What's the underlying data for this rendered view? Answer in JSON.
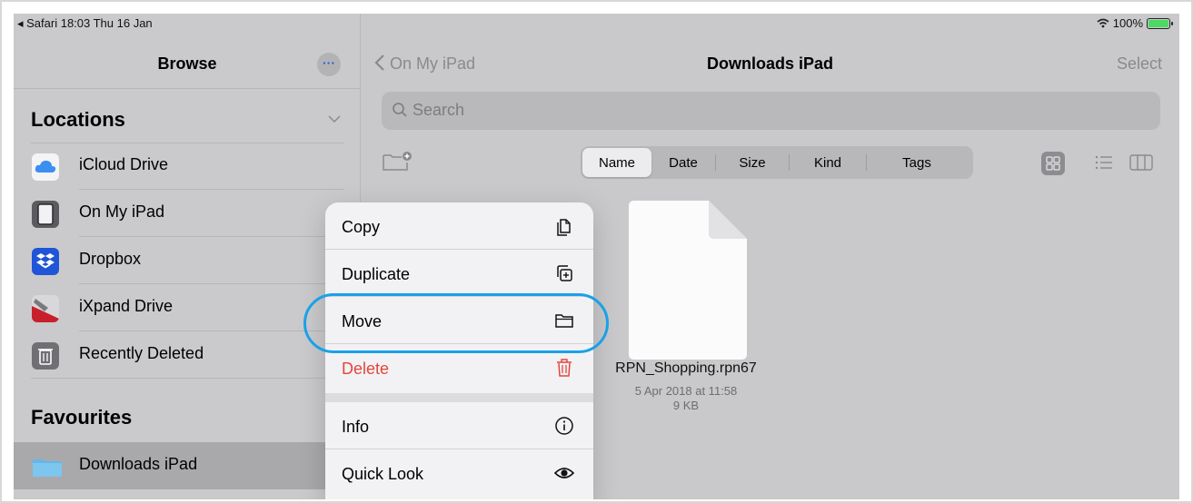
{
  "status": {
    "left": "◂ Safari  18:03  Thu 16 Jan",
    "battery_text": "100%",
    "wifi_icon": "wifi-icon"
  },
  "sidebar": {
    "title": "Browse",
    "more_label": "···",
    "locations_title": "Locations",
    "locations": [
      {
        "label": "iCloud Drive",
        "icon": "icloud-icon"
      },
      {
        "label": "On My iPad",
        "icon": "ipad-icon"
      },
      {
        "label": "Dropbox",
        "icon": "dropbox-icon"
      },
      {
        "label": "iXpand Drive",
        "icon": "ixpand-icon"
      },
      {
        "label": "Recently Deleted",
        "icon": "trash-icon"
      }
    ],
    "favourites_title": "Favourites",
    "favourites": [
      {
        "label": "Downloads iPad",
        "icon": "folder-icon",
        "selected": true
      }
    ]
  },
  "main": {
    "back_label": "On My iPad",
    "title": "Downloads iPad",
    "select_label": "Select",
    "search_placeholder": "Search",
    "sort": [
      "Name",
      "Date",
      "Size",
      "Kind",
      "Tags"
    ],
    "sort_active": "Name",
    "file": {
      "name": "RPN_Shopping.rpn67",
      "date": "5 Apr 2018 at 11:58",
      "size": "9 KB"
    }
  },
  "menu": {
    "items": [
      {
        "label": "Copy",
        "icon": "copy-icon"
      },
      {
        "label": "Duplicate",
        "icon": "duplicate-icon"
      },
      {
        "label": "Move",
        "icon": "folder-icon",
        "highlighted": true
      },
      {
        "label": "Delete",
        "icon": "trash-icon",
        "destructive": true
      },
      {
        "label": "Info",
        "icon": "info-icon"
      },
      {
        "label": "Quick Look",
        "icon": "eye-icon"
      }
    ]
  },
  "colors": {
    "accent": "#2b5fd9",
    "highlight_ring": "#1aa1e8",
    "destructive": "#e5453b"
  }
}
